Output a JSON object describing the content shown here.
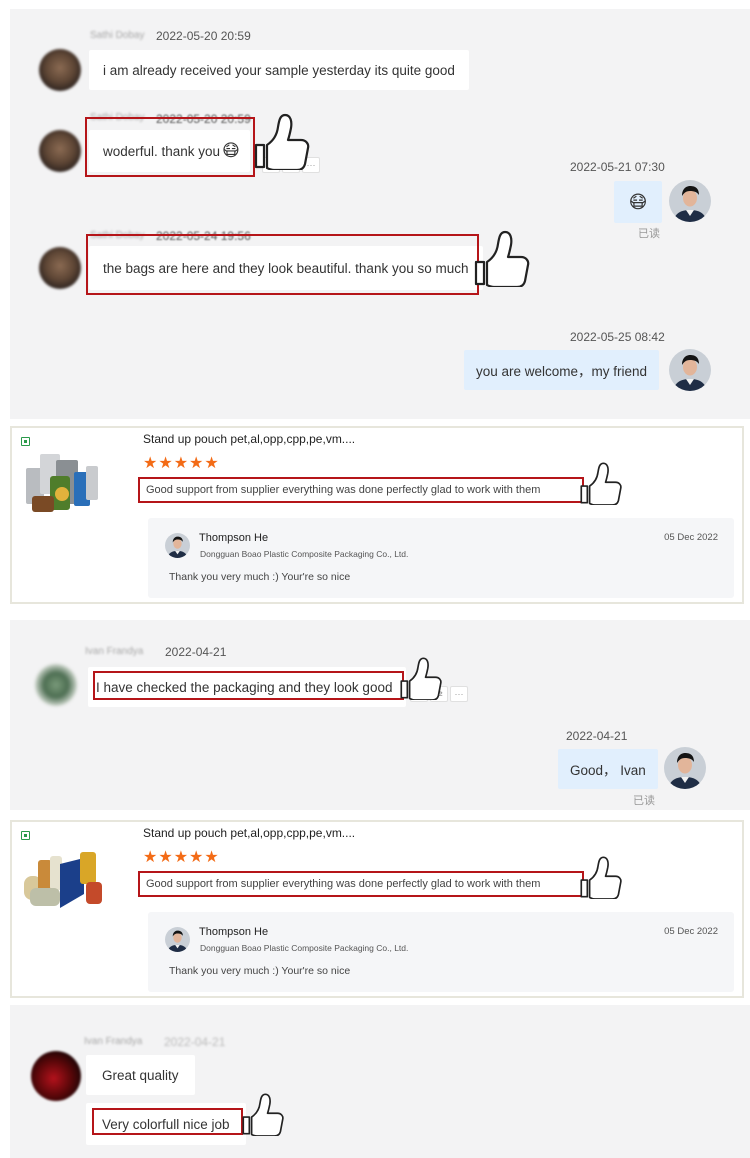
{
  "conversation1": {
    "msg1": {
      "sender": "Sathi Dobay",
      "time": "2022-05-20 20:59",
      "text": "i am already received your sample yesterday its quite good"
    },
    "msg2": {
      "sender": "Sathi Dobay",
      "time": "2022-05-20 20:59",
      "text": "woderful. thank you",
      "more": "···"
    },
    "reply1": {
      "time": "2022-05-21 07:30",
      "emoji": "😷",
      "status": "已读"
    },
    "msg3": {
      "sender": "Sathi Dobay",
      "time": "2022-05-24 19:56",
      "text": "the bags are here and they look beautiful. thank you so much"
    },
    "reply2": {
      "time": "2022-05-25 08:42",
      "text": "you are welcome，my friend"
    }
  },
  "review1": {
    "product": "Stand up pouch pet,al,opp,cpp,pe,vm....",
    "stars": "★★★★★",
    "rating": 5,
    "comment": "Good support from supplier everything was done perfectly glad to work with them",
    "reply": {
      "name": "Thompson He",
      "company": "Dongguan Boao Plastic Composite Packaging Co., Ltd.",
      "date": "05 Dec 2022",
      "text": "Thank you very much :) Your're so nice"
    }
  },
  "conversation2": {
    "msg1": {
      "sender": "Ivan Frandya",
      "time": "2022-04-21",
      "text": "I have checked the packaging and they look good",
      "more": "···"
    },
    "reply1": {
      "time": "2022-04-21",
      "text": "Good， Ivan",
      "status": "已读"
    }
  },
  "review2": {
    "product": "Stand up pouch pet,al,opp,cpp,pe,vm....",
    "stars": "★★★★★",
    "rating": 5,
    "comment": "Good support from supplier everything was done perfectly glad to work with them",
    "reply": {
      "name": "Thompson He",
      "company": "Dongguan Boao Plastic Composite Packaging Co., Ltd.",
      "date": "05 Dec 2022",
      "text": "Thank you very much :) Your're so nice"
    }
  },
  "conversation3": {
    "sender": "Ivan Frandya",
    "time": "2022-04-21",
    "msg1": "Great quality",
    "msg2": "Very colorfull nice job"
  },
  "colors": {
    "highlight_box": "#b51519",
    "star": "#f36b16",
    "outgoing_bubble": "#e1effd",
    "panel_bg": "#f3f3f4"
  }
}
